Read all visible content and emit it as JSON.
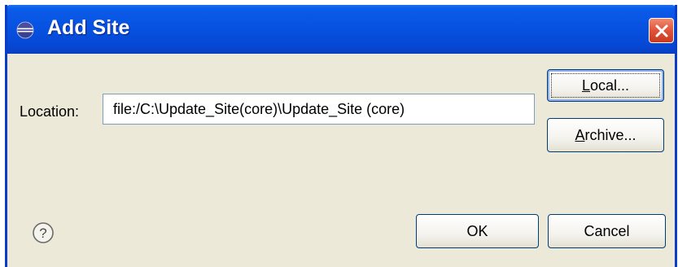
{
  "window": {
    "title": "Add Site",
    "title_icon": "eclipse-icon",
    "close_icon": "close-icon"
  },
  "location": {
    "label": "Location:",
    "value": "file:/C:\\Update_Site(core)\\Update_Site (core)"
  },
  "buttons": {
    "local": {
      "mnemonic": "L",
      "rest": "ocal..."
    },
    "archive": {
      "mnemonic": "A",
      "rest": "rchive..."
    },
    "ok": "OK",
    "cancel": "Cancel"
  },
  "help_icon": "help-icon",
  "colors": {
    "titlebar": "#0751e0",
    "dialog_bg": "#ece9d8",
    "close_button": "#e0533a",
    "button_border": "#003c74"
  }
}
